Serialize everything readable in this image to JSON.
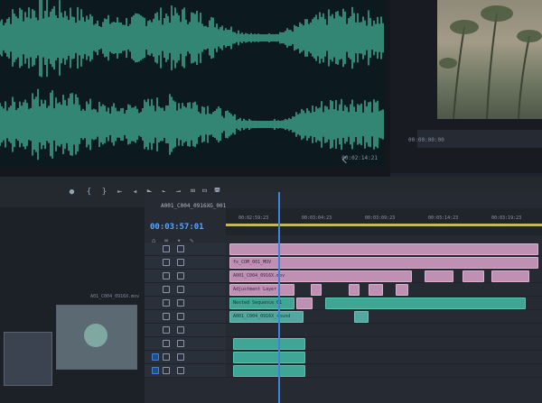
{
  "source_monitor": {
    "waveform_timecode": "00:02:14:21"
  },
  "program_monitor": {
    "timecode": "00:00:00:00"
  },
  "transport": {
    "icons": [
      "marker-icon",
      "in-point-icon",
      "out-point-icon",
      "go-to-in-icon",
      "step-back-icon",
      "play-icon",
      "step-forward-icon",
      "go-to-out-icon",
      "insert-icon",
      "overwrite-icon",
      "camera-icon"
    ]
  },
  "project": {
    "item_label": "A01_C004_0916X.mov"
  },
  "timeline": {
    "sequence_name": "A001_C004_0916XG_001",
    "playhead_timecode": "00:03:57:01",
    "ruler_labels": [
      "00:02:59:23",
      "00:03:04:23",
      "00:03:09:23",
      "00:03:14:23",
      "00:03:19:23"
    ],
    "clip_labels": {
      "v3": "fx_COM_001_MOV",
      "v2": "A001_C004_0916X.mov",
      "v1": "Adjustment Layer",
      "a1": "Nested Sequence 01",
      "a2": "A001_C004_0916X_sound"
    }
  },
  "colors": {
    "waveform": "#49c6a4",
    "clip_pink": "#c08fb4",
    "clip_green": "#3fa695",
    "playhead": "#3f83d9",
    "timecode_blue": "#57a6ff",
    "work_area": "#c7b75c"
  }
}
